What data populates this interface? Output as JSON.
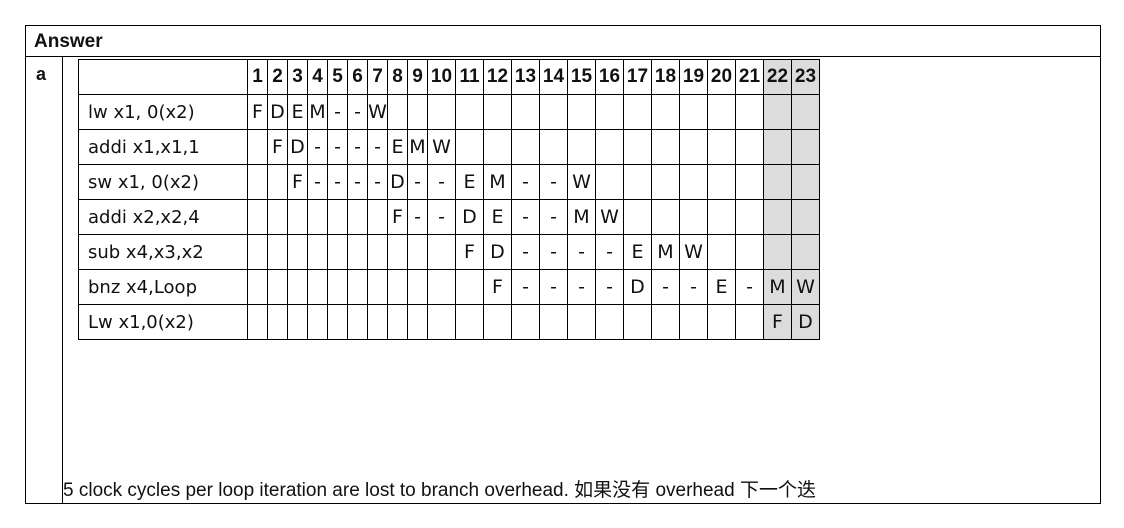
{
  "header": {
    "title": "Answer"
  },
  "part": {
    "label": "a"
  },
  "table": {
    "columns": [
      "1",
      "2",
      "3",
      "4",
      "5",
      "6",
      "7",
      "8",
      "9",
      "10",
      "11",
      "12",
      "13",
      "14",
      "15",
      "16",
      "17",
      "18",
      "19",
      "20",
      "21",
      "22",
      "23"
    ],
    "shaded_columns": [
      "22",
      "23"
    ],
    "rows": [
      {
        "instruction": "lw x1, 0(x2)",
        "stages": [
          "F",
          "D",
          "E",
          "M",
          "-",
          "-",
          "W",
          "",
          "",
          "",
          "",
          "",
          "",
          "",
          "",
          "",
          "",
          "",
          "",
          "",
          "",
          "",
          ""
        ]
      },
      {
        "instruction": "addi x1,x1,1",
        "stages": [
          "",
          "F",
          "D",
          "-",
          "-",
          "-",
          "-",
          "E",
          "M",
          "W",
          "",
          "",
          "",
          "",
          "",
          "",
          "",
          "",
          "",
          "",
          "",
          "",
          ""
        ]
      },
      {
        "instruction": "sw  x1, 0(x2)",
        "stages": [
          "",
          "",
          "F",
          "-",
          "-",
          "-",
          "-",
          "D",
          "-",
          "-",
          "E",
          "M",
          "-",
          "-",
          "W",
          "",
          "",
          "",
          "",
          "",
          "",
          "",
          ""
        ]
      },
      {
        "instruction": "addi x2,x2,4",
        "stages": [
          "",
          "",
          "",
          "",
          "",
          "",
          "",
          "F",
          "-",
          "-",
          "D",
          "E",
          "-",
          "-",
          "M",
          "W",
          "",
          "",
          "",
          "",
          "",
          "",
          ""
        ]
      },
      {
        "instruction": "sub x4,x3,x2",
        "stages": [
          "",
          "",
          "",
          "",
          "",
          "",
          "",
          "",
          "",
          "",
          "F",
          "D",
          "-",
          "-",
          "-",
          "-",
          "E",
          "M",
          "W",
          "",
          "",
          "",
          ""
        ]
      },
      {
        "instruction": "bnz x4,Loop",
        "stages": [
          "",
          "",
          "",
          "",
          "",
          "",
          "",
          "",
          "",
          "",
          "",
          "F",
          "-",
          "-",
          "-",
          "-",
          "D",
          "-",
          "-",
          "E",
          "-",
          "M",
          "W"
        ]
      },
      {
        "instruction": "Lw x1,0(x2)",
        "stages": [
          "",
          "",
          "",
          "",
          "",
          "",
          "",
          "",
          "",
          "",
          "",
          "",
          "",
          "",
          "",
          "",
          "",
          "",
          "",
          "",
          "",
          "F",
          "D"
        ]
      }
    ]
  },
  "note": {
    "text": "5 clock cycles per loop iteration are lost to branch overhead.  如果没有 overhead 下一个迭"
  },
  "colors": {
    "shade": "#dcdcdc",
    "border": "#000000"
  }
}
